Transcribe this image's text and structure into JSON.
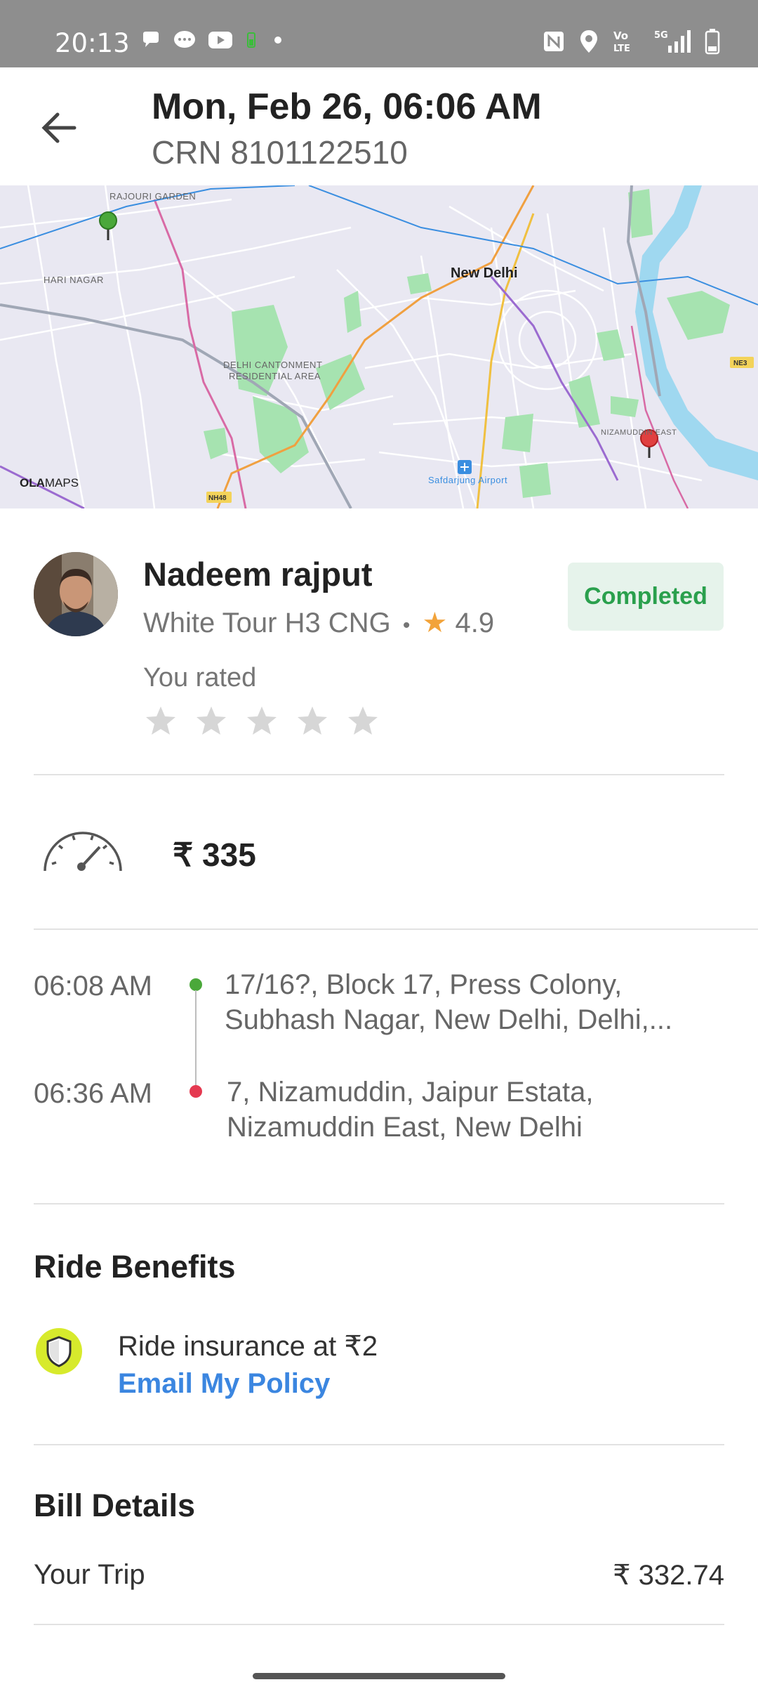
{
  "status_bar": {
    "time": "20:13",
    "left_icons": [
      "chat-bubble-icon",
      "messages-icon",
      "youtube-icon",
      "battery-saver-icon",
      "dot-icon"
    ],
    "right_icons": [
      "nfc-icon",
      "location-icon",
      "volte-icon",
      "5g-signal-icon",
      "battery-icon"
    ],
    "volte_text": "Vo LTE",
    "network_text": "5G"
  },
  "header": {
    "title": "Mon, Feb 26, 06:06 AM",
    "subtitle": "CRN 8101122510",
    "back_icon": "arrow-left-icon"
  },
  "map": {
    "labels": {
      "rajouri": "RAJOURI GARDEN",
      "hari": "HARI NAGAR",
      "cantonment_1": "DELHI CANTONMENT",
      "cantonment_2": "RESIDENTIAL AREA",
      "city": "New Delhi",
      "nizamuddin": "NIZAMUDDIN EAST",
      "airport": "Safdarjung Airport",
      "nh48": "NH48",
      "ne3": "NE3",
      "brand_bold": "OLA",
      "brand_rest": "MAPS"
    },
    "colors": {
      "background": "#e9e8f2",
      "park": "#a6e3b0",
      "water": "#9fd8f0",
      "road_orange": "#f0a040",
      "road_purple": "#9b6bd0",
      "road_pink": "#d86aa5",
      "road_blue": "#3a8ee0",
      "pickup_pin": "#4aa83a",
      "drop_pin": "#e04040"
    }
  },
  "driver": {
    "name": "Nadeem rajput",
    "vehicle": "White Tour H3 CNG",
    "separator": "•",
    "rating_star": "★",
    "rating": "4.9",
    "status": "Completed",
    "you_rated": "You rated",
    "stars_given": 0,
    "stars_total": 5
  },
  "fare": {
    "icon": "speedometer-icon",
    "amount": "₹ 335"
  },
  "trip": {
    "pickup_time": "06:08 AM",
    "pickup_line1": "17/16?, Block 17, Press Colony,",
    "pickup_line2": "Subhash Nagar, New Delhi, Delhi,...",
    "drop_time": "06:36 AM",
    "drop_line1": "7, Nizamuddin, Jaipur Estata,",
    "drop_line2": "Nizamuddin East, New Delhi",
    "colors": {
      "pickup": "#4aa83a",
      "drop": "#e53950"
    }
  },
  "benefits": {
    "title": "Ride Benefits",
    "insurance": "Ride insurance at ₹2",
    "email_link": "Email My Policy",
    "icon": "shield-icon"
  },
  "bill": {
    "title": "Bill Details",
    "trip_label": "Your Trip",
    "trip_value": "₹ 332.74"
  }
}
